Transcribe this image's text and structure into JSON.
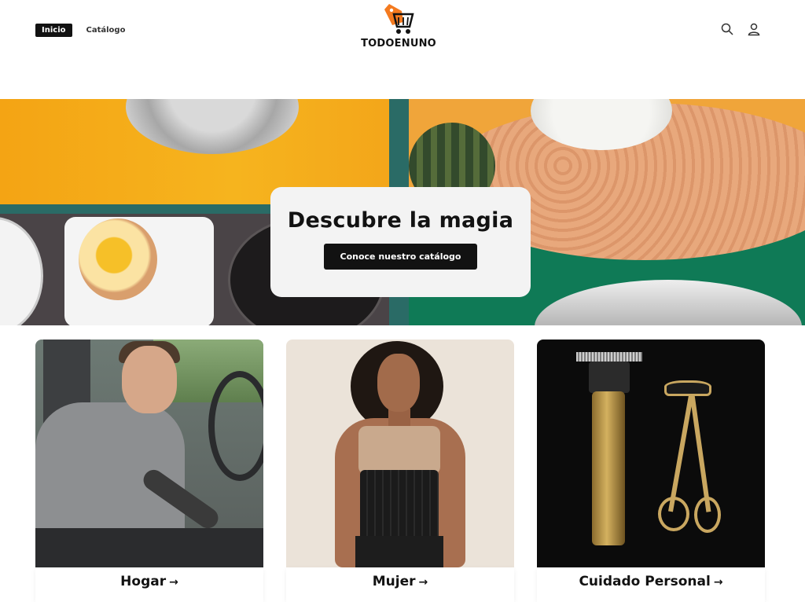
{
  "nav": {
    "items": [
      {
        "label": "Inicio",
        "active": true
      },
      {
        "label": "Catálogo",
        "active": false
      }
    ]
  },
  "brand": {
    "name": "TODOENUNO",
    "accent": "#f47a1f"
  },
  "header_icons": [
    "search-icon",
    "account-icon"
  ],
  "hero": {
    "title": "Descubre la magia",
    "button_label": "Conoce nuestro catálogo"
  },
  "categories": [
    {
      "title": "Hogar",
      "arrow": "→"
    },
    {
      "title": "Mujer",
      "arrow": "→"
    },
    {
      "title": "Cuidado Personal",
      "arrow": "→"
    }
  ]
}
